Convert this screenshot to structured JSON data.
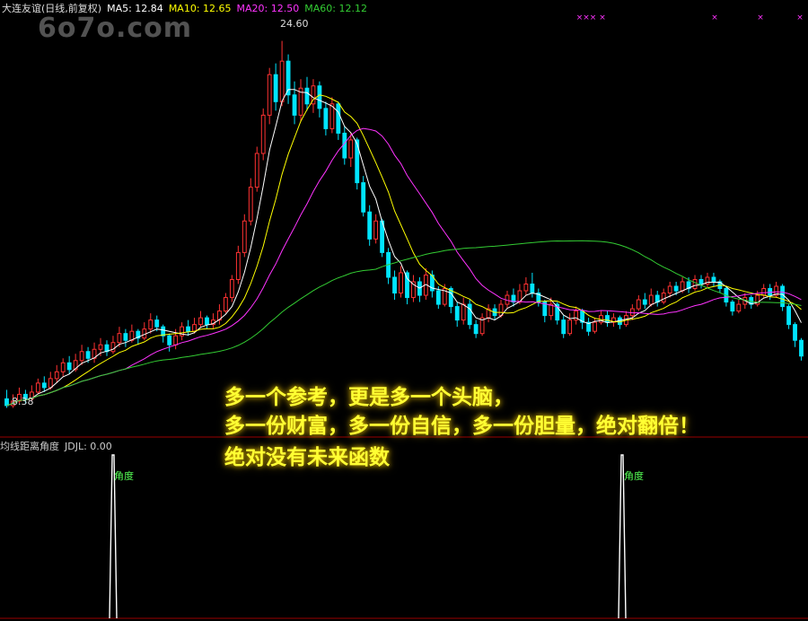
{
  "header": {
    "title": "大连友谊(日线,前复权)",
    "ma5": "MA5: 12.84",
    "ma10": "MA10: 12.65",
    "ma20": "MA20: 12.50",
    "ma60": "MA60: 12.12"
  },
  "watermark": "6o7o.com",
  "price_labels": {
    "high": "24.60",
    "low": "8.38"
  },
  "indicator": {
    "title": "均线距离角度",
    "value": "JDJL: 0.00",
    "label1": "角度",
    "label2": "角度"
  },
  "overlay_text": [
    "多一个参考，更是多一个头脑，",
    "多一份财富，多一份自信，多一份胆量，绝对翻倍！",
    "绝对没有未来函数"
  ],
  "top_marks": [
    "×××",
    "×",
    "×",
    "×",
    "×"
  ],
  "colors": {
    "up": "#ff3232",
    "down": "#00e5ff",
    "ma5": "#ffffff",
    "ma10": "#ffff00",
    "ma20": "#ff33ff",
    "ma60": "#33cc33",
    "separator": "#9a0000"
  },
  "chart_data": {
    "type": "candlestick",
    "y_range": [
      8.0,
      25.3
    ],
    "candles": [
      [
        8.7,
        8.4,
        9.1,
        8.3
      ],
      [
        8.4,
        8.6,
        8.9,
        8.3
      ],
      [
        8.6,
        8.9,
        9.2,
        8.5
      ],
      [
        8.9,
        8.7,
        9.1,
        8.5
      ],
      [
        8.7,
        9.0,
        9.3,
        8.6
      ],
      [
        9.0,
        9.4,
        9.6,
        8.9
      ],
      [
        9.4,
        9.2,
        9.7,
        9.0
      ],
      [
        9.2,
        9.6,
        9.9,
        9.1
      ],
      [
        9.6,
        9.9,
        10.2,
        9.4
      ],
      [
        9.9,
        10.3,
        10.5,
        9.7
      ],
      [
        10.3,
        10.0,
        10.6,
        9.8
      ],
      [
        10.0,
        10.4,
        10.7,
        9.9
      ],
      [
        10.4,
        10.8,
        11.1,
        10.2
      ],
      [
        10.8,
        10.5,
        11.0,
        10.3
      ],
      [
        10.5,
        10.9,
        11.2,
        10.3
      ],
      [
        10.9,
        11.1,
        11.4,
        10.6
      ],
      [
        11.1,
        10.8,
        11.3,
        10.6
      ],
      [
        10.8,
        11.2,
        11.5,
        10.7
      ],
      [
        11.2,
        11.6,
        11.9,
        11.0
      ],
      [
        11.6,
        11.3,
        11.8,
        11.0
      ],
      [
        11.3,
        11.7,
        12.0,
        11.2
      ],
      [
        11.7,
        11.4,
        11.8,
        11.1
      ],
      [
        11.4,
        11.8,
        12.1,
        11.3
      ],
      [
        11.8,
        12.2,
        12.5,
        11.6
      ],
      [
        12.2,
        11.9,
        12.4,
        11.7
      ],
      [
        11.9,
        11.5,
        12.0,
        11.2
      ],
      [
        11.5,
        11.1,
        11.6,
        10.8
      ],
      [
        11.1,
        11.5,
        11.8,
        10.9
      ],
      [
        11.5,
        11.9,
        12.1,
        11.3
      ],
      [
        11.9,
        11.7,
        12.2,
        11.5
      ],
      [
        11.7,
        12.0,
        12.3,
        11.6
      ],
      [
        12.0,
        12.3,
        12.6,
        11.9
      ],
      [
        12.3,
        12.0,
        12.4,
        11.8
      ],
      [
        12.0,
        12.2,
        12.5,
        11.8
      ],
      [
        12.2,
        12.6,
        12.9,
        12.0
      ],
      [
        12.6,
        13.2,
        13.4,
        12.5
      ],
      [
        13.2,
        14.0,
        14.2,
        13.0
      ],
      [
        14.0,
        15.2,
        15.5,
        13.8
      ],
      [
        15.2,
        16.6,
        16.9,
        15.0
      ],
      [
        16.6,
        18.1,
        18.5,
        16.4
      ],
      [
        18.1,
        19.6,
        19.9,
        17.9
      ],
      [
        19.6,
        21.3,
        21.6,
        19.3
      ],
      [
        21.3,
        23.1,
        23.4,
        20.9
      ],
      [
        23.1,
        21.9,
        23.6,
        21.5
      ],
      [
        21.9,
        23.7,
        24.6,
        21.7
      ],
      [
        23.7,
        22.2,
        24.0,
        21.8
      ],
      [
        22.2,
        21.3,
        22.8,
        20.9
      ],
      [
        21.3,
        22.5,
        22.9,
        21.0
      ],
      [
        22.5,
        21.8,
        23.0,
        21.5
      ],
      [
        21.8,
        22.6,
        22.9,
        21.4
      ],
      [
        22.6,
        21.6,
        22.8,
        21.2
      ],
      [
        21.6,
        20.7,
        21.9,
        20.4
      ],
      [
        20.7,
        21.8,
        22.1,
        20.5
      ],
      [
        21.8,
        20.5,
        21.9,
        20.2
      ],
      [
        20.5,
        19.4,
        20.8,
        19.1
      ],
      [
        19.4,
        20.2,
        20.5,
        19.0
      ],
      [
        20.2,
        18.3,
        20.3,
        18.0
      ],
      [
        18.3,
        17.0,
        18.6,
        16.8
      ],
      [
        17.0,
        15.8,
        17.3,
        15.5
      ],
      [
        15.8,
        16.6,
        16.9,
        15.6
      ],
      [
        16.6,
        15.2,
        16.7,
        15.0
      ],
      [
        15.2,
        14.1,
        15.4,
        13.8
      ],
      [
        14.1,
        13.4,
        14.4,
        13.1
      ],
      [
        13.4,
        14.3,
        14.6,
        13.2
      ],
      [
        14.3,
        13.2,
        14.4,
        12.9
      ],
      [
        13.2,
        13.9,
        14.2,
        13.0
      ],
      [
        13.9,
        13.3,
        14.1,
        13.0
      ],
      [
        13.3,
        14.2,
        14.5,
        13.1
      ],
      [
        14.2,
        13.5,
        14.4,
        13.2
      ],
      [
        13.5,
        12.9,
        13.7,
        12.7
      ],
      [
        12.9,
        13.6,
        13.8,
        12.8
      ],
      [
        13.6,
        12.8,
        13.7,
        12.5
      ],
      [
        12.8,
        12.2,
        13.0,
        11.9
      ],
      [
        12.2,
        12.9,
        13.2,
        12.0
      ],
      [
        12.9,
        12.0,
        13.1,
        11.8
      ],
      [
        12.0,
        11.6,
        12.2,
        11.4
      ],
      [
        11.6,
        12.3,
        12.5,
        11.5
      ],
      [
        12.3,
        12.7,
        12.9,
        12.1
      ],
      [
        12.7,
        12.4,
        12.9,
        12.2
      ],
      [
        12.4,
        12.9,
        13.1,
        12.3
      ],
      [
        12.9,
        13.3,
        13.5,
        12.7
      ],
      [
        13.3,
        13.0,
        13.6,
        12.8
      ],
      [
        13.0,
        13.5,
        13.8,
        12.9
      ],
      [
        13.5,
        13.8,
        14.1,
        13.3
      ],
      [
        13.8,
        13.4,
        14.3,
        13.2
      ],
      [
        13.4,
        13.0,
        13.6,
        12.8
      ],
      [
        13.0,
        12.4,
        13.1,
        12.1
      ],
      [
        12.4,
        12.9,
        13.2,
        12.2
      ],
      [
        12.9,
        12.2,
        13.0,
        12.0
      ],
      [
        12.2,
        11.6,
        12.4,
        11.4
      ],
      [
        11.6,
        12.2,
        12.5,
        11.5
      ],
      [
        12.2,
        12.6,
        12.8,
        12.0
      ],
      [
        12.6,
        12.1,
        12.7,
        11.8
      ],
      [
        12.1,
        11.7,
        12.3,
        11.5
      ],
      [
        11.7,
        12.1,
        12.3,
        11.6
      ],
      [
        12.1,
        12.4,
        12.6,
        12.0
      ],
      [
        12.4,
        12.1,
        12.6,
        11.9
      ],
      [
        12.1,
        12.3,
        12.5,
        11.9
      ],
      [
        12.3,
        12.0,
        12.4,
        11.8
      ],
      [
        12.0,
        12.4,
        12.6,
        11.9
      ],
      [
        12.4,
        12.7,
        12.9,
        12.2
      ],
      [
        12.7,
        13.1,
        13.3,
        12.6
      ],
      [
        13.1,
        12.9,
        13.4,
        12.7
      ],
      [
        12.9,
        13.3,
        13.6,
        12.8
      ],
      [
        13.3,
        13.0,
        13.5,
        12.8
      ],
      [
        13.0,
        13.4,
        13.6,
        12.9
      ],
      [
        13.4,
        13.7,
        13.9,
        13.2
      ],
      [
        13.7,
        13.5,
        13.9,
        13.3
      ],
      [
        13.5,
        13.9,
        14.1,
        13.4
      ],
      [
        13.9,
        13.6,
        14.1,
        13.4
      ],
      [
        13.6,
        14.0,
        14.2,
        13.5
      ],
      [
        14.0,
        13.8,
        14.2,
        13.6
      ],
      [
        13.8,
        14.1,
        14.3,
        13.6
      ],
      [
        14.1,
        13.9,
        14.3,
        13.7
      ],
      [
        13.9,
        13.6,
        14.0,
        13.4
      ],
      [
        13.6,
        13.0,
        13.7,
        12.8
      ],
      [
        13.0,
        12.6,
        13.1,
        12.4
      ],
      [
        12.6,
        12.9,
        13.1,
        12.5
      ],
      [
        12.9,
        13.2,
        13.4,
        12.7
      ],
      [
        13.2,
        12.9,
        13.3,
        12.7
      ],
      [
        12.9,
        13.3,
        13.5,
        12.8
      ],
      [
        13.3,
        13.6,
        13.8,
        13.2
      ],
      [
        13.6,
        13.3,
        13.8,
        13.1
      ],
      [
        13.3,
        13.7,
        13.9,
        13.2
      ],
      [
        13.7,
        12.8,
        13.8,
        12.6
      ],
      [
        12.8,
        12.0,
        12.9,
        11.8
      ],
      [
        12.0,
        11.3,
        12.1,
        11.0
      ],
      [
        11.3,
        10.6,
        11.4,
        10.4
      ]
    ],
    "indicator_spikes": [
      [
        0.14,
        1.0
      ],
      [
        0.77,
        1.0
      ]
    ],
    "indicator_range": [
      0,
      1
    ]
  }
}
